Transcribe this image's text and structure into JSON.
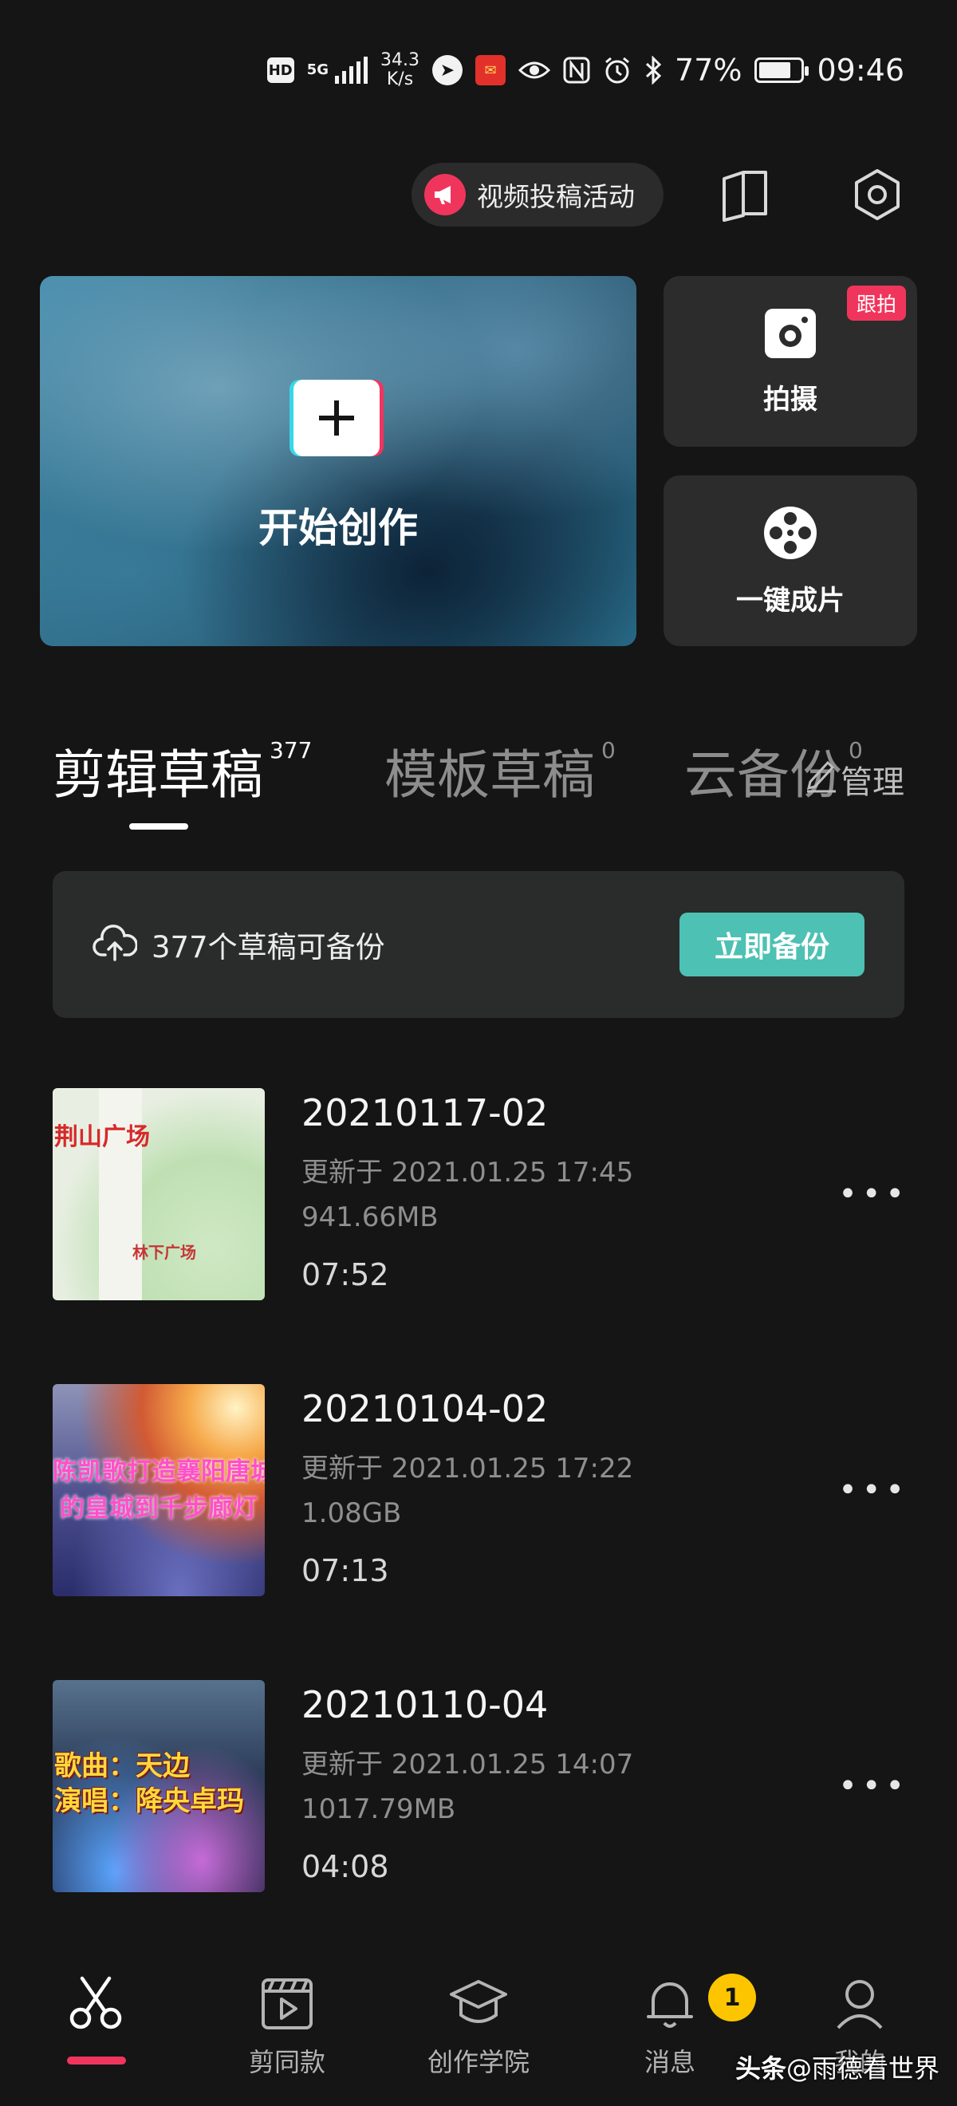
{
  "status_bar": {
    "hd": "HD",
    "network": "5G",
    "speed_value": "34.3",
    "speed_unit": "K/s",
    "battery_percent": "77%",
    "battery_level": 0.77,
    "time": "09:46",
    "icons": [
      "hd-icon",
      "5g-signal-icon",
      "app-notification-icon",
      "app-red-icon",
      "eye-icon",
      "nfc-icon",
      "alarm-icon",
      "bluetooth-icon",
      "battery-icon"
    ]
  },
  "header": {
    "promo_label": "视频投稿活动",
    "promo_icon": "megaphone-icon",
    "tutorial_icon": "book-icon",
    "settings_icon": "gear-icon"
  },
  "hero": {
    "create_label": "开始创作",
    "shoot_label": "拍摄",
    "shoot_badge": "跟拍",
    "one_click_label": "一键成片"
  },
  "tabs": [
    {
      "label": "剪辑草稿",
      "count": "377",
      "active": true
    },
    {
      "label": "模板草稿",
      "count": "0",
      "active": false
    },
    {
      "label": "云备份",
      "count": "0",
      "active": false
    }
  ],
  "manage_label": "管理",
  "backup": {
    "text": "377个草稿可备份",
    "button": "立即备份"
  },
  "drafts": [
    {
      "title": "20210117-02",
      "updated": "更新于 2021.01.25 17:45",
      "size": "941.66MB",
      "duration": "07:52",
      "thumb_text": [
        "荆山广场",
        "林下广场"
      ]
    },
    {
      "title": "20210104-02",
      "updated": "更新于 2021.01.25 17:22",
      "size": "1.08GB",
      "duration": "07:13",
      "thumb_text": [
        "陈凯歌打造襄阳唐城",
        "的皇城到千步廊灯"
      ]
    },
    {
      "title": "20210110-04",
      "updated": "更新于 2021.01.25 14:07",
      "size": "1017.79MB",
      "duration": "04:08",
      "thumb_text": [
        "歌曲：天边",
        "演唱：降央卓玛"
      ]
    }
  ],
  "more_label": "•••",
  "bottom_nav": [
    {
      "label": "",
      "icon": "scissors-icon",
      "active": true
    },
    {
      "label": "剪同款",
      "icon": "clapperboard-icon",
      "active": false
    },
    {
      "label": "创作学院",
      "icon": "graduation-cap-icon",
      "active": false
    },
    {
      "label": "消息",
      "icon": "bell-icon",
      "active": false,
      "badge": "1"
    },
    {
      "label": "我的",
      "icon": "user-icon",
      "active": false
    }
  ],
  "watermark": {
    "brand": "头条",
    "handle": "@雨德看世界"
  },
  "colors": {
    "accent": "#f0355d",
    "backup_button": "#4dc1b3",
    "badge": "#fcc500",
    "background": "#151515"
  }
}
